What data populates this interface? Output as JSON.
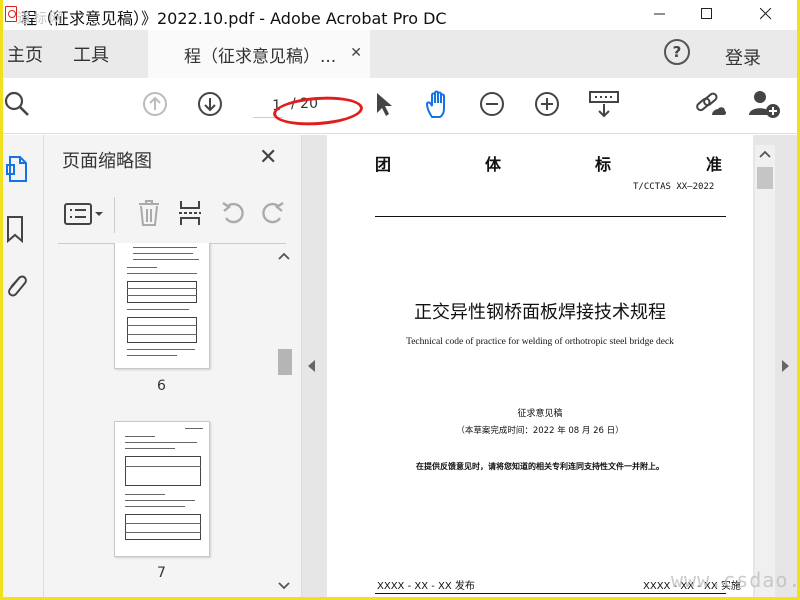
{
  "window": {
    "title": "程（征求意见稿）》2022.10.pdf - Adobe Acrobat Pro DC",
    "watermark_top": "道标网",
    "watermark_bottom": "www.csdao.com"
  },
  "tabs": {
    "home": "主页",
    "tools": "工具",
    "document": "程（征求意见稿）...",
    "help": "?",
    "login": "登录"
  },
  "toolbar": {
    "current_page": "1",
    "page_count": "/ 20",
    "annotation_color": "#e01e1e"
  },
  "thumbnails_panel": {
    "title": "页面缩略图",
    "pages": [
      {
        "label": "6"
      },
      {
        "label": "7"
      }
    ]
  },
  "document": {
    "header_chars": [
      "团",
      "体",
      "标",
      "准"
    ],
    "standard_number": "T/CCTAS XX—2022",
    "title_cn": "正交异性钢桥面板焊接技术规程",
    "title_en": "Technical code of practice for welding of orthotropic steel bridge deck",
    "draft": "征求意见稿",
    "date_note": "（本草案完成时间：2022 年 08 月 26 日）",
    "feedback_note": "在提供反馈意见时，请将您知道的相关专利连同支持性文件一并附上。",
    "footer_left": "XXXX - XX - XX 发布",
    "footer_right": "XXXX - XX - XX 实施"
  },
  "icons": {
    "search": "search-icon",
    "prev": "arrow-up-circle-icon",
    "next": "arrow-down-circle-icon",
    "select": "pointer-icon",
    "hand": "hand-icon",
    "zoom_out": "zoom-out-icon",
    "zoom_in": "zoom-in-icon",
    "keyboard": "keyboard-icon",
    "share": "link-share-icon",
    "add_user": "add-user-icon"
  }
}
